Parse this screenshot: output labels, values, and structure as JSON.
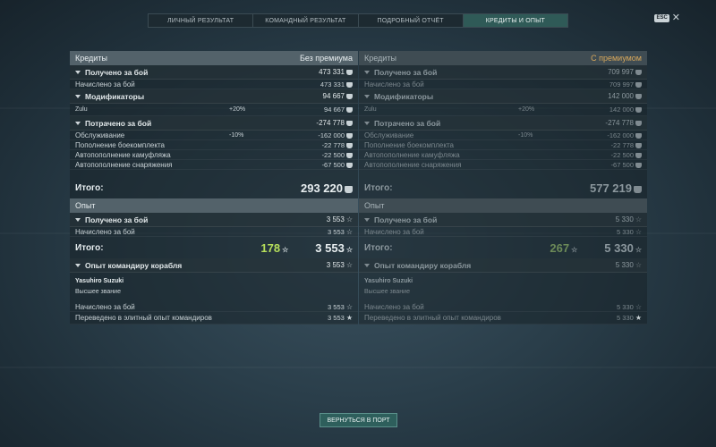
{
  "tabs": [
    "ЛИЧНЫЙ РЕЗУЛЬТАТ",
    "КОМАНДНЫЙ РЕЗУЛЬТАТ",
    "ПОДРОБНЫЙ ОТЧЁТ",
    "КРЕДИТЫ И ОПЫТ"
  ],
  "active_tab": 3,
  "esc_label": "ESC",
  "left": {
    "credits_header": "Кредиты",
    "premium_label": "Без премиума",
    "received": {
      "label": "Получено за бой",
      "value": "473 331"
    },
    "accrued": {
      "label": "Начислено за бой",
      "value": "473 331"
    },
    "modifiers": {
      "label": "Модификаторы",
      "value": "94 667"
    },
    "zulu": {
      "label": "Zulu",
      "mod": "+20%",
      "value": "94 667"
    },
    "spent": {
      "label": "Потрачено за бой",
      "value": "-274 778"
    },
    "service": {
      "label": "Обслуживание",
      "mod": "-10%",
      "value": "-162 000"
    },
    "ammo": {
      "label": "Пополнение боекомплекта",
      "value": "-22 778"
    },
    "camo": {
      "label": "Автопополнение камуфляжа",
      "value": "-22 500"
    },
    "equip": {
      "label": "Автопополнение снаряжения",
      "value": "-67 500"
    },
    "credits_total": {
      "label": "Итого:",
      "value": "293 220"
    },
    "xp_header": "Опыт",
    "xp_received": {
      "label": "Получено за бой",
      "value": "3 553"
    },
    "xp_accrued": {
      "label": "Начислено за бой",
      "value": "3 553"
    },
    "xp_total": {
      "label": "Итого:",
      "free": "178",
      "value": "3 553"
    },
    "cmdr_xp": {
      "label": "Опыт командиру корабля",
      "value": "3 553"
    },
    "cmdr_name": "Yasuhiro Suzuki",
    "cmdr_rank": "Высшее звание",
    "cmdr_accrued": {
      "label": "Начислено за бой",
      "value": "3 553"
    },
    "cmdr_elite": {
      "label": "Переведено в элитный опыт командиров",
      "value": "3 553"
    }
  },
  "right": {
    "credits_header": "Кредиты",
    "premium_label": "С премиумом",
    "received": {
      "label": "Получено за бой",
      "value": "709 997"
    },
    "accrued": {
      "label": "Начислено за бой",
      "value": "709 997"
    },
    "modifiers": {
      "label": "Модификаторы",
      "value": "142 000"
    },
    "zulu": {
      "label": "Zulu",
      "mod": "+20%",
      "value": "142 000"
    },
    "spent": {
      "label": "Потрачено за бой",
      "value": "-274 778"
    },
    "service": {
      "label": "Обслуживание",
      "mod": "-10%",
      "value": "-162 000"
    },
    "ammo": {
      "label": "Пополнение боекомплекта",
      "value": "-22 778"
    },
    "camo": {
      "label": "Автопополнение камуфляжа",
      "value": "-22 500"
    },
    "equip": {
      "label": "Автопополнение снаряжения",
      "value": "-67 500"
    },
    "credits_total": {
      "label": "Итого:",
      "value": "577 219"
    },
    "xp_header": "Опыт",
    "xp_received": {
      "label": "Получено за бой",
      "value": "5 330"
    },
    "xp_accrued": {
      "label": "Начислено за бой",
      "value": "5 330"
    },
    "xp_total": {
      "label": "Итого:",
      "free": "267",
      "value": "5 330"
    },
    "cmdr_xp": {
      "label": "Опыт командиру корабля",
      "value": "5 330"
    },
    "cmdr_name": "Yasuhiro Suzuki",
    "cmdr_rank": "Высшее звание",
    "cmdr_accrued": {
      "label": "Начислено за бой",
      "value": "5 330"
    },
    "cmdr_elite": {
      "label": "Переведено в элитный опыт командиров",
      "value": "5 330"
    }
  },
  "return_button": "ВЕРНУТЬСЯ В ПОРТ"
}
